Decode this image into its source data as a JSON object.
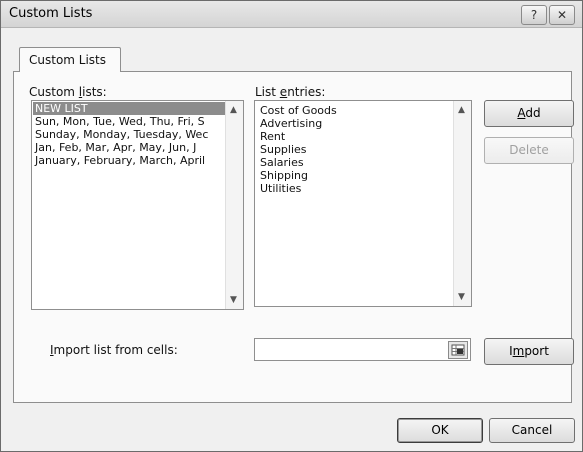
{
  "window": {
    "title": "Custom Lists"
  },
  "titlebar": {
    "help_label": "?",
    "close_label": "✕"
  },
  "tab": {
    "label": "Custom Lists"
  },
  "custom_lists": {
    "label_pre": "Custom ",
    "label_key": "l",
    "label_post": "ists:",
    "items": [
      {
        "label": "NEW LIST"
      },
      {
        "label": "Sun, Mon, Tue, Wed, Thu, Fri, S"
      },
      {
        "label": "Sunday, Monday, Tuesday, Wec"
      },
      {
        "label": "Jan, Feb, Mar, Apr, May, Jun, J"
      },
      {
        "label": "January, February, March, April"
      }
    ]
  },
  "list_entries": {
    "label_pre": "List ",
    "label_key": "e",
    "label_post": "ntries:",
    "items": [
      {
        "label": "Cost of Goods"
      },
      {
        "label": "Advertising"
      },
      {
        "label": "Rent"
      },
      {
        "label": "Supplies"
      },
      {
        "label": "Salaries"
      },
      {
        "label": "Shipping"
      },
      {
        "label": "Utilities"
      }
    ]
  },
  "buttons": {
    "add_key": "A",
    "add_rest": "dd",
    "delete": "Delete",
    "import_pre": "I",
    "import_key": "m",
    "import_rest": "port",
    "ok": "OK",
    "cancel": "Cancel"
  },
  "import_cells": {
    "label_pre": "",
    "label_key": "I",
    "label_post": "mport list from cells:",
    "value": ""
  },
  "icons": {
    "scroll_up": "▲",
    "scroll_down": "▼",
    "range_picker": "range-picker-icon"
  }
}
